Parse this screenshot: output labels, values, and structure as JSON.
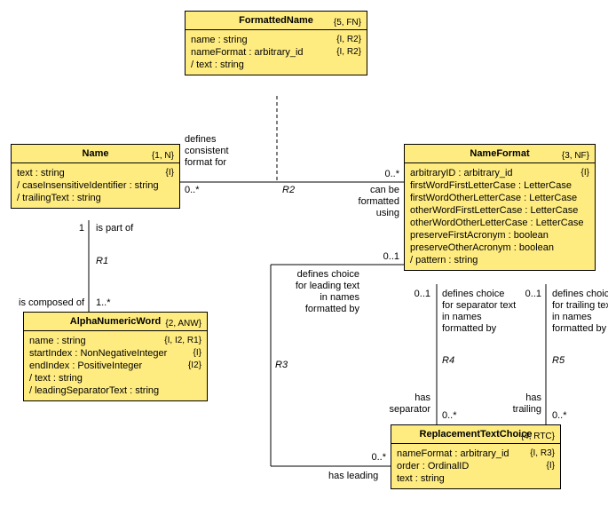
{
  "classes": {
    "FormattedName": {
      "title": "FormattedName",
      "tag": "{5, FN}",
      "attrs": [
        {
          "text": "  name : string",
          "tag": "{I, R2}"
        },
        {
          "text": "  nameFormat : arbitrary_id",
          "tag": "{I, R2}"
        },
        {
          "text": "/ text : string",
          "tag": ""
        }
      ]
    },
    "Name": {
      "title": "Name",
      "tag": "{1, N}",
      "attrs": [
        {
          "text": "  text : string",
          "tag": "{I}"
        },
        {
          "text": "/ caseInsensitiveIdentifier : string",
          "tag": ""
        },
        {
          "text": "/ trailingText : string",
          "tag": ""
        }
      ]
    },
    "NameFormat": {
      "title": "NameFormat",
      "tag": "{3, NF}",
      "attrs": [
        {
          "text": "  arbitraryID : arbitrary_id",
          "tag": "{I}"
        },
        {
          "text": "  firstWordFirstLetterCase : LetterCase",
          "tag": ""
        },
        {
          "text": "  firstWordOtherLetterCase : LetterCase",
          "tag": ""
        },
        {
          "text": "  otherWordFirstLetterCase : LetterCase",
          "tag": ""
        },
        {
          "text": "  otherWordOtherLetterCase : LetterCase",
          "tag": ""
        },
        {
          "text": "  preserveFirstAcronym : boolean",
          "tag": ""
        },
        {
          "text": "  preserveOtherAcronym : boolean",
          "tag": ""
        },
        {
          "text": "/ pattern : string",
          "tag": ""
        }
      ]
    },
    "AlphaNumericWord": {
      "title": "AlphaNumericWord",
      "tag": "{2, ANW}",
      "attrs": [
        {
          "text": "  name : string",
          "tag": "{I, I2, R1}"
        },
        {
          "text": "  startIndex : NonNegativeInteger",
          "tag": "{I}"
        },
        {
          "text": "  endIndex : PositiveInteger",
          "tag": "{I2}"
        },
        {
          "text": "/ text : string",
          "tag": ""
        },
        {
          "text": "/ leadingSeparatorText : string",
          "tag": ""
        }
      ]
    },
    "ReplacementTextChoice": {
      "title": "ReplacementTextChoice",
      "tag": "{4, RTC}",
      "attrs": [
        {
          "text": "  nameFormat : arbitrary_id",
          "tag": "{I, R3}"
        },
        {
          "text": "  order : OrdinalID",
          "tag": "{I}"
        },
        {
          "text": "  text : string",
          "tag": ""
        }
      ]
    }
  },
  "labels": {
    "r2_left_role": "defines\nconsistent\nformat for",
    "r2_left_mult": "0..*",
    "r2_name": "R2",
    "r2_right_role": "can be\nformatted\nusing",
    "r2_right_mult": "0..*",
    "r1_top_mult": "1",
    "r1_top_role": "is part of",
    "r1_name": "R1",
    "r1_bot_role": "is composed of",
    "r1_bot_mult": "1..*",
    "r3_top_mult": "0..1",
    "r3_top_role": "defines choice\nfor leading text\nin names\nformatted by",
    "r3_name": "R3",
    "r3_bot_role": "has leading",
    "r3_bot_mult": "0..*",
    "r4_top_mult": "0..1",
    "r4_top_role": "defines choice\nfor separator text\nin names\nformatted by",
    "r4_name": "R4",
    "r4_bot_role": "has\nseparator",
    "r4_bot_mult": "0..*",
    "r5_top_mult": "0..1",
    "r5_top_role": "defines choice\nfor trailing text\nin names\nformatted by",
    "r5_name": "R5",
    "r5_bot_role": "has\ntrailing",
    "r5_bot_mult": "0..*"
  }
}
